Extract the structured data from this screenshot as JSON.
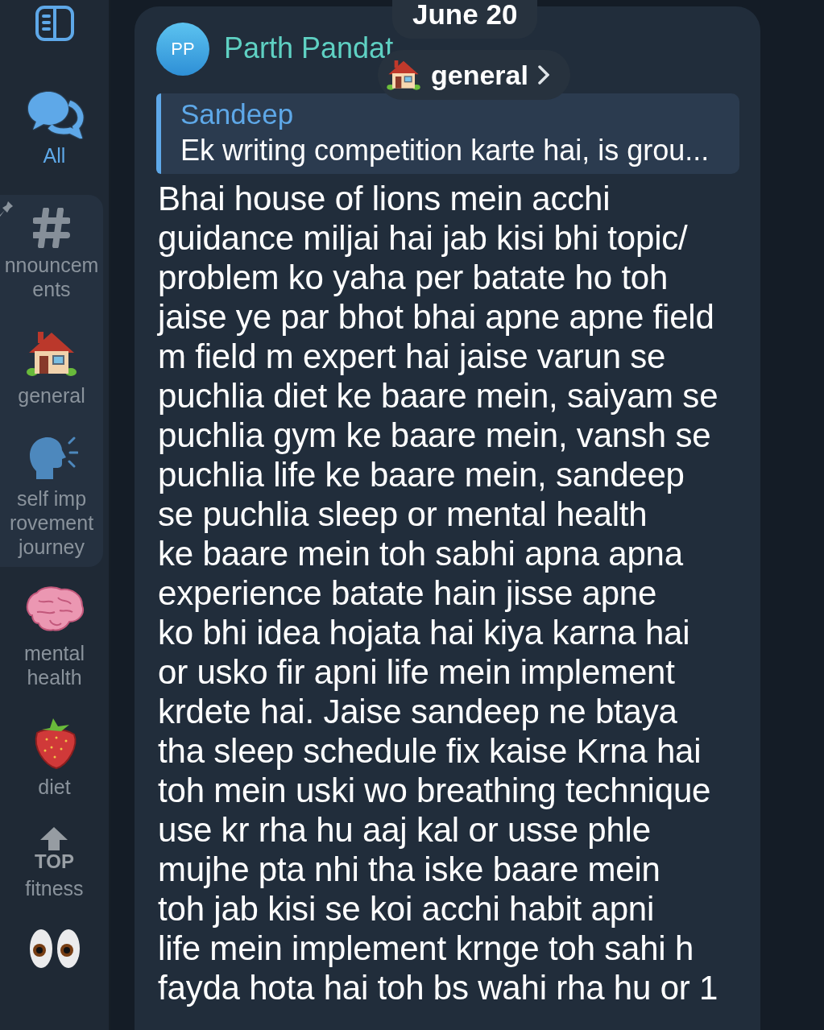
{
  "sidebar": {
    "top_items": [
      {
        "kind": "chats",
        "label_lines": [
          "All"
        ],
        "selected": true
      }
    ],
    "pinned_items": [
      {
        "kind": "hash",
        "label_lines": [
          "nnouncem",
          "ents"
        ],
        "selected": false
      },
      {
        "kind": "house",
        "label_lines": [
          "general"
        ],
        "selected": false
      },
      {
        "kind": "head",
        "label_lines": [
          "self imp",
          "rovement",
          "journey"
        ],
        "selected": false
      }
    ],
    "items": [
      {
        "kind": "brain",
        "label_lines": [
          "mental",
          "health"
        ],
        "selected": false
      },
      {
        "kind": "strawberry",
        "label_lines": [
          "diet"
        ],
        "selected": false
      },
      {
        "kind": "top",
        "icon_text": "TOP",
        "label_lines": [
          "fitness"
        ],
        "selected": false
      },
      {
        "kind": "eyes",
        "selected": false
      }
    ]
  },
  "date": "June 20",
  "topic": {
    "label": "general"
  },
  "message": {
    "avatar": "PP",
    "author": "Parth Pandat",
    "reply": {
      "author": "Sandeep",
      "text": "Ek writing competition karte hai, is grou..."
    },
    "text_lines": [
      "Bhai house of lions mein acchi",
      "guidance miljai hai jab kisi bhi topic/",
      "problem ko yaha per batate ho toh",
      "jaise ye par bhot bhai apne apne field",
      "m field m expert hai jaise varun se",
      "puchlia diet ke baare mein, saiyam se",
      "puchlia gym ke baare mein, vansh se",
      "puchlia life ke baare mein, sandeep",
      "se puchlia sleep or mental health",
      "ke baare mein toh sabhi apna apna",
      "experience batate hain jisse apne",
      "ko bhi idea hojata hai kiya karna hai",
      "or usko fir apni life mein implement",
      "krdete hai. Jaise sandeep ne btaya",
      "tha sleep schedule fix kaise Krna hai",
      "toh mein uski wo breathing technique",
      "use kr rha hu aaj kal or usse phle",
      "mujhe pta nhi tha iske baare mein",
      "toh jab kisi se koi acchi habit apni",
      "life mein implement krnge toh sahi h",
      "fayda hota hai toh bs wahi rha hu or 1"
    ]
  }
}
